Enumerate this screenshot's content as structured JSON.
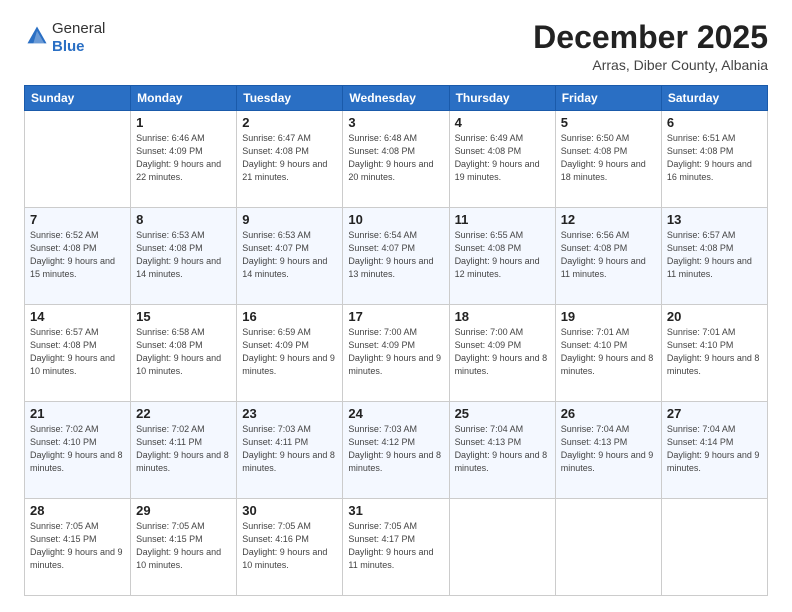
{
  "header": {
    "logo": {
      "line1": "General",
      "line2": "Blue"
    },
    "title": "December 2025",
    "location": "Arras, Diber County, Albania"
  },
  "weekdays": [
    "Sunday",
    "Monday",
    "Tuesday",
    "Wednesday",
    "Thursday",
    "Friday",
    "Saturday"
  ],
  "weeks": [
    [
      {
        "day": "",
        "sunrise": "",
        "sunset": "",
        "daylight": ""
      },
      {
        "day": "1",
        "sunrise": "Sunrise: 6:46 AM",
        "sunset": "Sunset: 4:09 PM",
        "daylight": "Daylight: 9 hours and 22 minutes."
      },
      {
        "day": "2",
        "sunrise": "Sunrise: 6:47 AM",
        "sunset": "Sunset: 4:08 PM",
        "daylight": "Daylight: 9 hours and 21 minutes."
      },
      {
        "day": "3",
        "sunrise": "Sunrise: 6:48 AM",
        "sunset": "Sunset: 4:08 PM",
        "daylight": "Daylight: 9 hours and 20 minutes."
      },
      {
        "day": "4",
        "sunrise": "Sunrise: 6:49 AM",
        "sunset": "Sunset: 4:08 PM",
        "daylight": "Daylight: 9 hours and 19 minutes."
      },
      {
        "day": "5",
        "sunrise": "Sunrise: 6:50 AM",
        "sunset": "Sunset: 4:08 PM",
        "daylight": "Daylight: 9 hours and 18 minutes."
      },
      {
        "day": "6",
        "sunrise": "Sunrise: 6:51 AM",
        "sunset": "Sunset: 4:08 PM",
        "daylight": "Daylight: 9 hours and 16 minutes."
      }
    ],
    [
      {
        "day": "7",
        "sunrise": "Sunrise: 6:52 AM",
        "sunset": "Sunset: 4:08 PM",
        "daylight": "Daylight: 9 hours and 15 minutes."
      },
      {
        "day": "8",
        "sunrise": "Sunrise: 6:53 AM",
        "sunset": "Sunset: 4:08 PM",
        "daylight": "Daylight: 9 hours and 14 minutes."
      },
      {
        "day": "9",
        "sunrise": "Sunrise: 6:53 AM",
        "sunset": "Sunset: 4:07 PM",
        "daylight": "Daylight: 9 hours and 14 minutes."
      },
      {
        "day": "10",
        "sunrise": "Sunrise: 6:54 AM",
        "sunset": "Sunset: 4:07 PM",
        "daylight": "Daylight: 9 hours and 13 minutes."
      },
      {
        "day": "11",
        "sunrise": "Sunrise: 6:55 AM",
        "sunset": "Sunset: 4:08 PM",
        "daylight": "Daylight: 9 hours and 12 minutes."
      },
      {
        "day": "12",
        "sunrise": "Sunrise: 6:56 AM",
        "sunset": "Sunset: 4:08 PM",
        "daylight": "Daylight: 9 hours and 11 minutes."
      },
      {
        "day": "13",
        "sunrise": "Sunrise: 6:57 AM",
        "sunset": "Sunset: 4:08 PM",
        "daylight": "Daylight: 9 hours and 11 minutes."
      }
    ],
    [
      {
        "day": "14",
        "sunrise": "Sunrise: 6:57 AM",
        "sunset": "Sunset: 4:08 PM",
        "daylight": "Daylight: 9 hours and 10 minutes."
      },
      {
        "day": "15",
        "sunrise": "Sunrise: 6:58 AM",
        "sunset": "Sunset: 4:08 PM",
        "daylight": "Daylight: 9 hours and 10 minutes."
      },
      {
        "day": "16",
        "sunrise": "Sunrise: 6:59 AM",
        "sunset": "Sunset: 4:09 PM",
        "daylight": "Daylight: 9 hours and 9 minutes."
      },
      {
        "day": "17",
        "sunrise": "Sunrise: 7:00 AM",
        "sunset": "Sunset: 4:09 PM",
        "daylight": "Daylight: 9 hours and 9 minutes."
      },
      {
        "day": "18",
        "sunrise": "Sunrise: 7:00 AM",
        "sunset": "Sunset: 4:09 PM",
        "daylight": "Daylight: 9 hours and 8 minutes."
      },
      {
        "day": "19",
        "sunrise": "Sunrise: 7:01 AM",
        "sunset": "Sunset: 4:10 PM",
        "daylight": "Daylight: 9 hours and 8 minutes."
      },
      {
        "day": "20",
        "sunrise": "Sunrise: 7:01 AM",
        "sunset": "Sunset: 4:10 PM",
        "daylight": "Daylight: 9 hours and 8 minutes."
      }
    ],
    [
      {
        "day": "21",
        "sunrise": "Sunrise: 7:02 AM",
        "sunset": "Sunset: 4:10 PM",
        "daylight": "Daylight: 9 hours and 8 minutes."
      },
      {
        "day": "22",
        "sunrise": "Sunrise: 7:02 AM",
        "sunset": "Sunset: 4:11 PM",
        "daylight": "Daylight: 9 hours and 8 minutes."
      },
      {
        "day": "23",
        "sunrise": "Sunrise: 7:03 AM",
        "sunset": "Sunset: 4:11 PM",
        "daylight": "Daylight: 9 hours and 8 minutes."
      },
      {
        "day": "24",
        "sunrise": "Sunrise: 7:03 AM",
        "sunset": "Sunset: 4:12 PM",
        "daylight": "Daylight: 9 hours and 8 minutes."
      },
      {
        "day": "25",
        "sunrise": "Sunrise: 7:04 AM",
        "sunset": "Sunset: 4:13 PM",
        "daylight": "Daylight: 9 hours and 8 minutes."
      },
      {
        "day": "26",
        "sunrise": "Sunrise: 7:04 AM",
        "sunset": "Sunset: 4:13 PM",
        "daylight": "Daylight: 9 hours and 9 minutes."
      },
      {
        "day": "27",
        "sunrise": "Sunrise: 7:04 AM",
        "sunset": "Sunset: 4:14 PM",
        "daylight": "Daylight: 9 hours and 9 minutes."
      }
    ],
    [
      {
        "day": "28",
        "sunrise": "Sunrise: 7:05 AM",
        "sunset": "Sunset: 4:15 PM",
        "daylight": "Daylight: 9 hours and 9 minutes."
      },
      {
        "day": "29",
        "sunrise": "Sunrise: 7:05 AM",
        "sunset": "Sunset: 4:15 PM",
        "daylight": "Daylight: 9 hours and 10 minutes."
      },
      {
        "day": "30",
        "sunrise": "Sunrise: 7:05 AM",
        "sunset": "Sunset: 4:16 PM",
        "daylight": "Daylight: 9 hours and 10 minutes."
      },
      {
        "day": "31",
        "sunrise": "Sunrise: 7:05 AM",
        "sunset": "Sunset: 4:17 PM",
        "daylight": "Daylight: 9 hours and 11 minutes."
      },
      {
        "day": "",
        "sunrise": "",
        "sunset": "",
        "daylight": ""
      },
      {
        "day": "",
        "sunrise": "",
        "sunset": "",
        "daylight": ""
      },
      {
        "day": "",
        "sunrise": "",
        "sunset": "",
        "daylight": ""
      }
    ]
  ]
}
